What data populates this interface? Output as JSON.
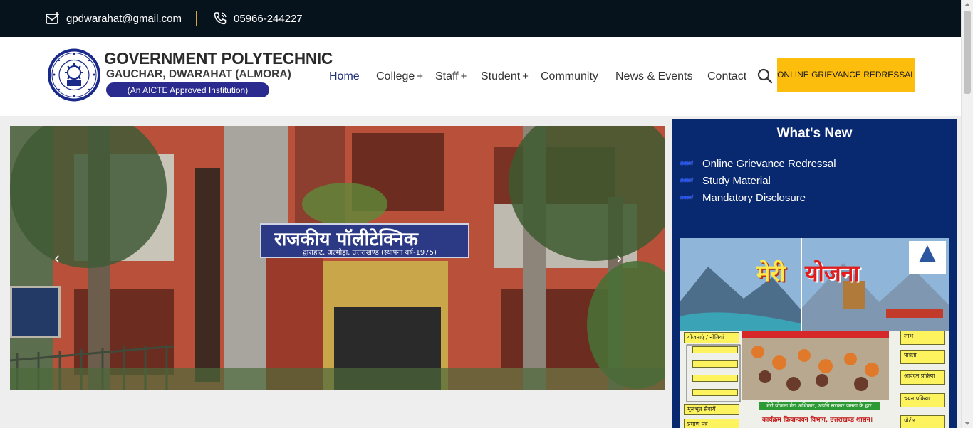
{
  "topbar": {
    "email": "gpdwarahat@gmail.com",
    "phone": "05966-244227"
  },
  "brand": {
    "title": "GOVERNMENT POLYTECHNIC",
    "subtitle": "GAUCHAR, DWARAHAT (ALMORA)",
    "tagline": "(An AICTE Approved Institution)"
  },
  "nav": {
    "home": "Home",
    "college": "College",
    "staff": "Staff",
    "student": "Student",
    "community": "Community",
    "news": "News & Events",
    "contact": "Contact",
    "expand_symbol": "+",
    "grievance_button": "ONLINE GRIEVANCE REDRESSAL"
  },
  "slider": {
    "sign_line_1": "राजकीय पॉलीटेक्निक",
    "sign_line_2": "द्वाराहाट, अल्मोड़ा, उत्तराखण्ड (स्थापना वर्ष-1975)",
    "prev_glyph": "‹",
    "next_glyph": "›"
  },
  "whats_new": {
    "title": "What's New",
    "badge": "new!",
    "items": [
      {
        "label": "Online Grievance Redressal"
      },
      {
        "label": "Study Material"
      },
      {
        "label": "Mandatory Disclosure"
      }
    ]
  },
  "poster": {
    "title_part_1": "मेरी",
    "title_part_2": "योजना",
    "left_boxes": [
      "योजनाएं / नीतियां",
      "मूलभूत सेवायें",
      "प्रमाण पत्र"
    ],
    "right_boxes": [
      "लाभ",
      "पात्रता",
      "आवेदन प्रक्रिया",
      "चयन प्रक्रिया",
      "पोर्टल"
    ],
    "banner": "मेरी योजना मेरा अधिकार, अपनि सरकार जनता के द्वार",
    "footer": "कार्यक्रम क्रियान्वयन विभाग, उत्तराखण्ड शासन।"
  },
  "colors": {
    "topbar_bg": "#07131c",
    "accent_button": "#fcbd0c",
    "panel_bg": "#08286f",
    "nav_active": "#1e2f7a",
    "brand_pill": "#2b2b8f"
  }
}
